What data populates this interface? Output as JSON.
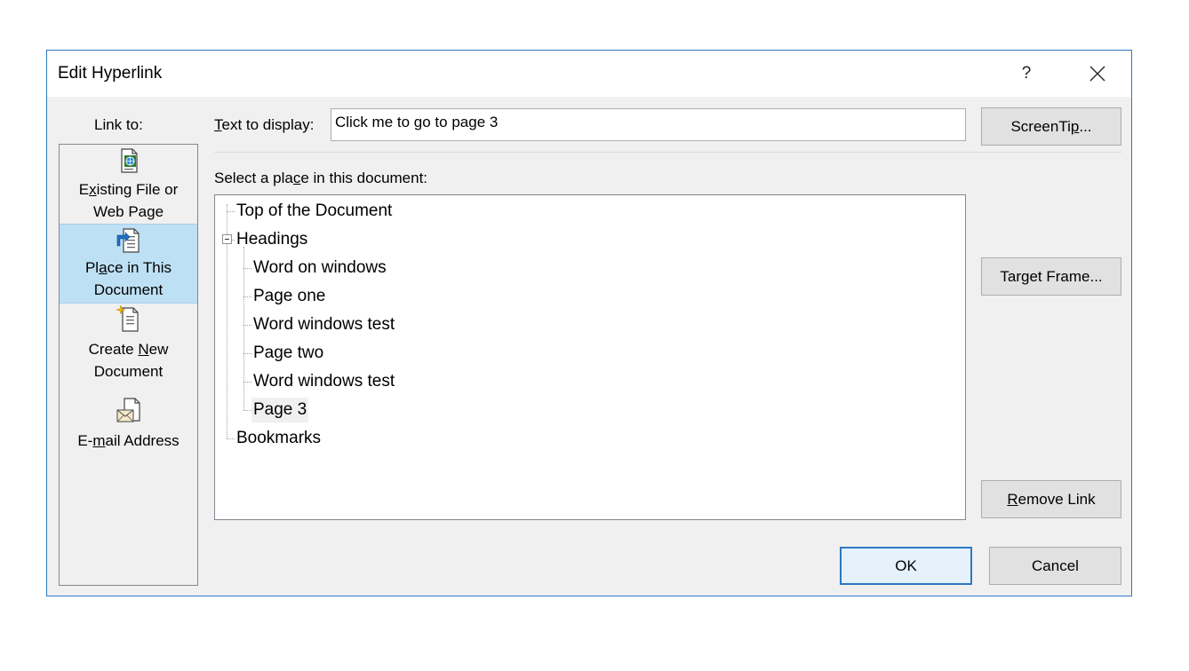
{
  "dialog": {
    "title": "Edit Hyperlink",
    "help_label": "?",
    "close_icon": "close-icon"
  },
  "link_to": {
    "label": "Link to:",
    "items": [
      {
        "line1_pre": "E",
        "line1_u": "x",
        "line1_post": "isting File or",
        "line2": "Web Page",
        "icon": "existing-file-icon",
        "selected": false
      },
      {
        "line1_pre": "Pl",
        "line1_u": "a",
        "line1_post": "ce in This",
        "line2": "Document",
        "icon": "place-in-document-icon",
        "selected": true
      },
      {
        "line1_pre": "Create ",
        "line1_u": "N",
        "line1_post": "ew",
        "line2": "Document",
        "icon": "new-document-icon",
        "selected": false
      },
      {
        "line1_pre": "E-",
        "line1_u": "m",
        "line1_post": "ail Address",
        "line2": "",
        "icon": "email-icon",
        "selected": false
      }
    ]
  },
  "text_to_display": {
    "label_u": "T",
    "label_rest": "ext to display:",
    "value": "Click me to go to page 3"
  },
  "select_place": {
    "label_pre": "Select a pla",
    "label_u": "c",
    "label_post": "e in this document:"
  },
  "tree": {
    "items": [
      {
        "label": "Top of the Document",
        "level": 0
      },
      {
        "label": "Headings",
        "level": 0,
        "expanded": true
      },
      {
        "label": "Word on windows",
        "level": 1
      },
      {
        "label": "Page one",
        "level": 1
      },
      {
        "label": "Word windows test",
        "level": 1
      },
      {
        "label": "Page two",
        "level": 1
      },
      {
        "label": "Word windows test",
        "level": 1
      },
      {
        "label": "Page 3",
        "level": 1,
        "highlighted": true
      },
      {
        "label": "Bookmarks",
        "level": 0
      }
    ]
  },
  "buttons": {
    "screentip_pre": "ScreenTi",
    "screentip_u": "p",
    "screentip_post": "...",
    "target_frame_pre": "Tar",
    "target_frame_u": "g",
    "target_frame_post": "et Frame...",
    "remove_link_u": "R",
    "remove_link_post": "emove Link",
    "ok": "OK",
    "cancel": "Cancel"
  },
  "colors": {
    "accent": "#2b79c2",
    "selection": "#bee0f5",
    "dialog_bg": "#f0f0f0"
  }
}
